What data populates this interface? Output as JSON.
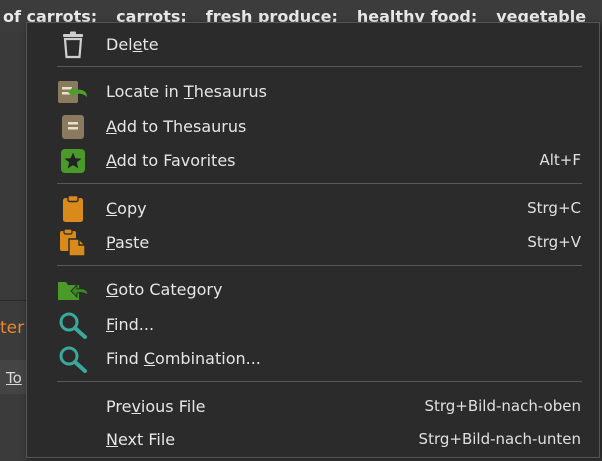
{
  "background": {
    "tags": [
      "of carrots;",
      "carrots;",
      "fresh produce;",
      "healthy food;",
      "vegetable"
    ],
    "partial_orange_text": "ter",
    "partial_link_text": "To"
  },
  "menu": {
    "items": [
      {
        "key": "delete",
        "pre": "Del",
        "u": "e",
        "post": "te",
        "shortcut": "",
        "icon": "trash-icon"
      },
      {
        "key": "locate",
        "pre": "Locate in ",
        "u": "T",
        "post": "hesaurus",
        "shortcut": "",
        "icon": "locate-book-icon"
      },
      {
        "key": "add-thesaurus",
        "pre": "",
        "u": "A",
        "post": "dd to Thesaurus",
        "shortcut": "",
        "icon": "book-icon"
      },
      {
        "key": "add-favorites",
        "pre": "",
        "u": "A",
        "post": "dd to Favorites",
        "shortcut": "Alt+F",
        "icon": "star-icon"
      },
      {
        "key": "copy",
        "pre": "",
        "u": "C",
        "post": "opy",
        "shortcut": "Strg+C",
        "icon": "clipboard-icon"
      },
      {
        "key": "paste",
        "pre": "",
        "u": "P",
        "post": "aste",
        "shortcut": "Strg+V",
        "icon": "paste-icon"
      },
      {
        "key": "goto-category",
        "pre": "",
        "u": "G",
        "post": "oto Category",
        "shortcut": "",
        "icon": "folder-arrow-icon"
      },
      {
        "key": "find",
        "pre": "",
        "u": "F",
        "post": "ind...",
        "shortcut": "",
        "icon": "magnifier-icon"
      },
      {
        "key": "find-combination",
        "pre": "Find ",
        "u": "C",
        "post": "ombination...",
        "shortcut": "",
        "icon": "magnifier-icon"
      },
      {
        "key": "previous-file",
        "pre": "Pre",
        "u": "v",
        "post": "ious File",
        "shortcut": "Strg+Bild-nach-oben",
        "icon": ""
      },
      {
        "key": "next-file",
        "pre": "",
        "u": "N",
        "post": "ext File",
        "shortcut": "Strg+Bild-nach-unten",
        "icon": ""
      }
    ]
  },
  "colors": {
    "menu_bg": "#2b2b2b",
    "separator": "#585858",
    "icon_brown": "#8a7a5e",
    "icon_green": "#4a9a2a",
    "icon_orange": "#d98a1a",
    "icon_teal": "#3aa89a"
  }
}
